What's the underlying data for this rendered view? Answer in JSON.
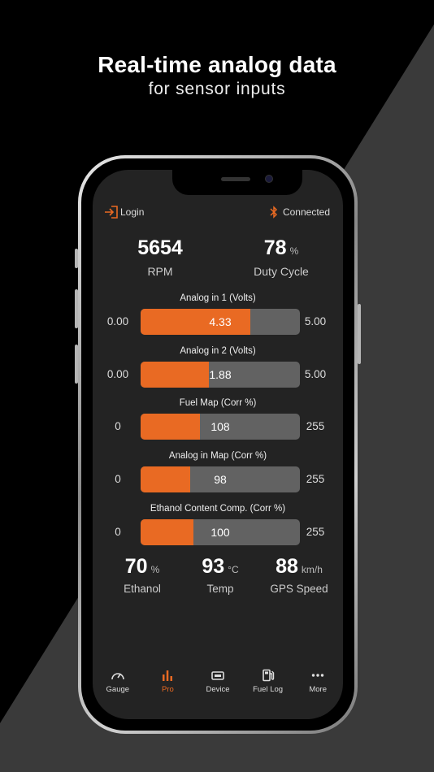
{
  "marketing": {
    "headline": "Real-time analog data",
    "subline": "for sensor inputs"
  },
  "colors": {
    "accent": "#e96a23",
    "bar_track": "#626262",
    "screen_bg": "#232323"
  },
  "header": {
    "login_label": "Login",
    "login_icon": "login-icon",
    "status_label": "Connected",
    "status_icon": "bluetooth-icon"
  },
  "top_stats": [
    {
      "value": "5654",
      "unit": "",
      "label": "RPM"
    },
    {
      "value": "78",
      "unit": "%",
      "label": "Duty Cycle"
    }
  ],
  "bars": [
    {
      "title": "Analog in 1 (Volts)",
      "min": "0.00",
      "max": "5.00",
      "value": "4.33",
      "fill": 0.69
    },
    {
      "title": "Analog in 2 (Volts)",
      "min": "0.00",
      "max": "5.00",
      "value": "1.88",
      "fill": 0.43
    },
    {
      "title": "Fuel Map (Corr %)",
      "min": "0",
      "max": "255",
      "value": "108",
      "fill": 0.37
    },
    {
      "title": "Analog in Map (Corr %)",
      "min": "0",
      "max": "255",
      "value": "98",
      "fill": 0.31
    },
    {
      "title": "Ethanol Content Comp. (Corr %)",
      "min": "0",
      "max": "255",
      "value": "100",
      "fill": 0.33
    }
  ],
  "bottom_stats": [
    {
      "value": "70",
      "unit": "%",
      "label": "Ethanol"
    },
    {
      "value": "93",
      "unit": "°C",
      "label": "Temp"
    },
    {
      "value": "88",
      "unit": "km/h",
      "label": "GPS Speed"
    }
  ],
  "tabs": [
    {
      "label": "Gauge",
      "icon": "gauge-icon",
      "active": false
    },
    {
      "label": "Pro",
      "icon": "bar-chart-icon",
      "active": true
    },
    {
      "label": "Device",
      "icon": "device-icon",
      "active": false
    },
    {
      "label": "Fuel Log",
      "icon": "fuel-pump-icon",
      "active": false
    },
    {
      "label": "More",
      "icon": "more-icon",
      "active": false
    }
  ]
}
